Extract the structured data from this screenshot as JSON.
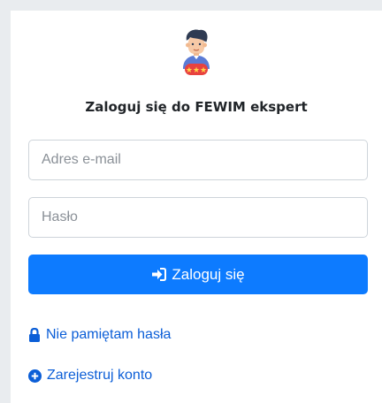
{
  "login": {
    "title": "Zaloguj się do FEWIM ekspert",
    "email_placeholder": "Adres e-mail",
    "password_placeholder": "Hasło",
    "submit_label": "Zaloguj się",
    "forgot_password_label": "Nie pamiętam hasła",
    "register_label": "Zarejestruj konto"
  },
  "icons": {
    "avatar": "expert-avatar-icon",
    "submit": "sign-in-icon",
    "forgot": "lock-icon",
    "register": "plus-circle-icon"
  },
  "colors": {
    "primary": "#0d7bff",
    "link": "#0b5ed7",
    "background": "#e9ecef"
  }
}
